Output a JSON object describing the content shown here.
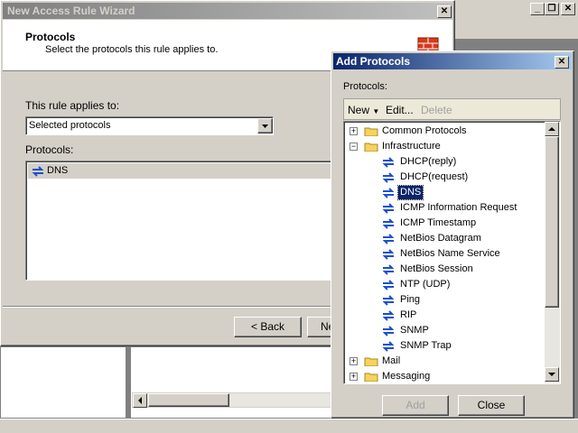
{
  "background_window": {
    "title": "",
    "close_glyph": "▫",
    "maximize_glyph": "▣",
    "left_panel_label": ""
  },
  "wizard": {
    "title": "New Access Rule Wizard",
    "close": "X",
    "header_title": "Protocols",
    "header_subtitle": "Select the protocols this rule applies to.",
    "applies_label": "This rule applies to:",
    "applies_value": "Selected protocols",
    "protocols_label": "Protocols:",
    "protocols": [
      "DNS"
    ],
    "back_button": "< Back",
    "next_button": "Ne"
  },
  "dialog": {
    "title": "Add Protocols",
    "close": "X",
    "protocols_label": "Protocols:",
    "toolbar": {
      "new": "New",
      "edit": "Edit...",
      "delete": "Delete"
    },
    "tree": [
      {
        "type": "folder",
        "label": "Common Protocols",
        "expanded": false
      },
      {
        "type": "folder",
        "label": "Infrastructure",
        "expanded": true
      },
      {
        "type": "protocol",
        "label": "DHCP(reply)"
      },
      {
        "type": "protocol",
        "label": "DHCP(request)"
      },
      {
        "type": "protocol",
        "label": "DNS",
        "selected": true
      },
      {
        "type": "protocol",
        "label": "ICMP Information Request"
      },
      {
        "type": "protocol",
        "label": "ICMP Timestamp"
      },
      {
        "type": "protocol",
        "label": "NetBios Datagram"
      },
      {
        "type": "protocol",
        "label": "NetBios Name Service"
      },
      {
        "type": "protocol",
        "label": "NetBios Session"
      },
      {
        "type": "protocol",
        "label": "NTP (UDP)"
      },
      {
        "type": "protocol",
        "label": "Ping"
      },
      {
        "type": "protocol",
        "label": "RIP"
      },
      {
        "type": "protocol",
        "label": "SNMP"
      },
      {
        "type": "protocol",
        "label": "SNMP Trap"
      },
      {
        "type": "folder",
        "label": "Mail",
        "expanded": false
      },
      {
        "type": "folder",
        "label": "Messaging",
        "expanded": false
      }
    ],
    "add_button": "Add",
    "close_button": "Close"
  }
}
